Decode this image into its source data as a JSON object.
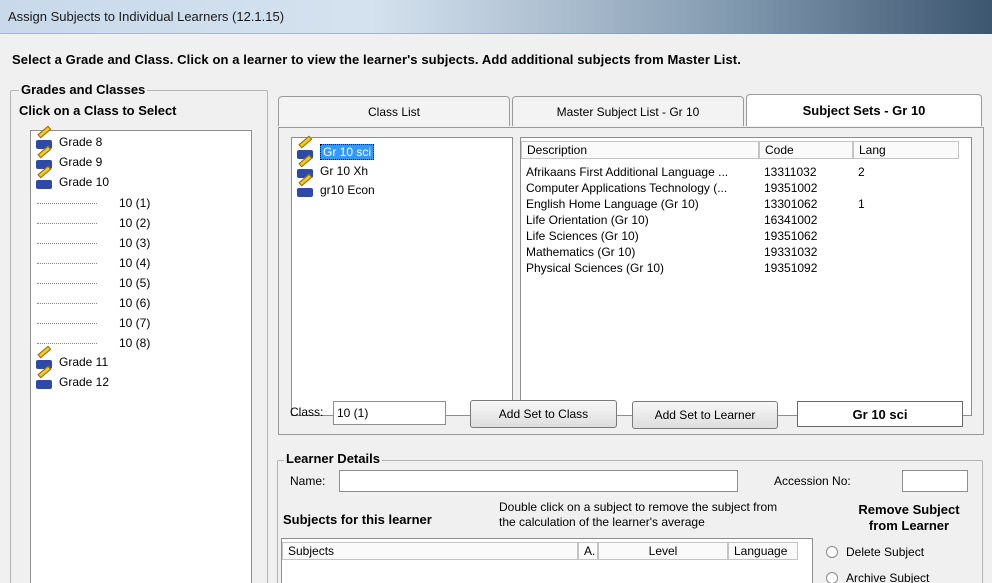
{
  "window": {
    "title": "Assign Subjects to Individual Learners (12.1.15)"
  },
  "instruction": "Select a Grade and Class. Click on a learner to view the learner's subjects. Add additional subjects from Master List.",
  "left_panel": {
    "group_title": "Grades and Classes",
    "subtitle": "Click on a Class to Select",
    "tree": {
      "grade8": "Grade 8",
      "grade9": "Grade 9",
      "grade10": "Grade 10",
      "classes": [
        "10 (1)",
        "10 (2)",
        "10 (3)",
        "10 (4)",
        "10 (5)",
        "10 (6)",
        "10 (7)",
        "10 (8)"
      ],
      "grade11": "Grade 11",
      "grade12": "Grade 12"
    }
  },
  "tabs": [
    "Class List",
    "Master Subject List - Gr 10",
    "Subject Sets - Gr 10"
  ],
  "subject_sets": [
    "Gr 10 sci",
    "Gr 10 Xh",
    "gr10 Econ"
  ],
  "subject_table": {
    "headers": [
      "Description",
      "Code",
      "Lang"
    ],
    "rows": [
      {
        "description": "Afrikaans First Additional Language ...",
        "code": "13311032",
        "lang": "2"
      },
      {
        "description": "Computer Applications Technology (...",
        "code": "19351002",
        "lang": ""
      },
      {
        "description": "English Home Language (Gr 10)",
        "code": "13301062",
        "lang": "1"
      },
      {
        "description": "Life Orientation (Gr 10)",
        "code": "16341002",
        "lang": ""
      },
      {
        "description": "Life Sciences (Gr 10)",
        "code": "19351062",
        "lang": ""
      },
      {
        "description": "Mathematics (Gr 10)",
        "code": "19331032",
        "lang": ""
      },
      {
        "description": "Physical Sciences (Gr 10)",
        "code": "19351092",
        "lang": ""
      }
    ]
  },
  "class_field": {
    "label": "Class:",
    "value": "10 (1)"
  },
  "buttons": {
    "add_set_to_class": "Add Set to Class",
    "add_set_to_learner": "Add Set to Learner"
  },
  "selected_set_name": "Gr 10 sci",
  "learner_details": {
    "group_title": "Learner Details",
    "name_label": "Name:",
    "name_value": "",
    "accession_label": "Accession No:",
    "accession_value": "",
    "subjects_title": "Subjects for this learner",
    "hint": "Double click on a subject to remove the subject from the calculation of the learner's average",
    "grid_headers": [
      "Subjects",
      "A.",
      "Level",
      "Language"
    ],
    "remove_title": "Remove Subject from Learner",
    "radio_delete": "Delete Subject",
    "radio_archive": "Archive Subject"
  }
}
